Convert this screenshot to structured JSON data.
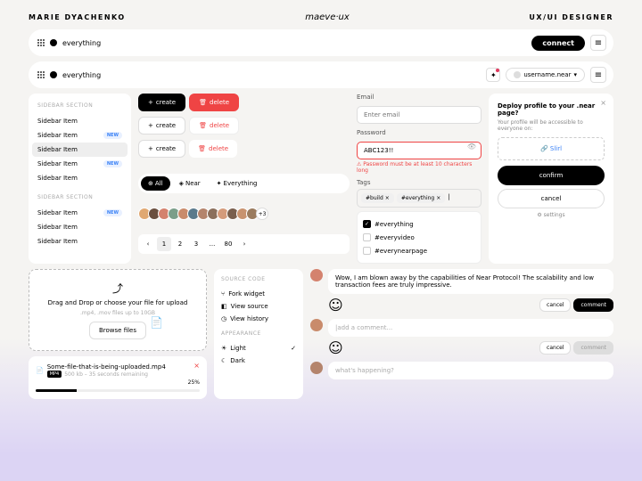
{
  "header": {
    "left": "MARIE DYACHENKO",
    "center": "maeve·ux",
    "right": "UX/UI DESIGNER"
  },
  "bars": {
    "brand": "everything",
    "connect": "connect",
    "username": "username.near"
  },
  "sidebar": {
    "title": "SIDEBAR SECTION",
    "items": [
      {
        "label": "Sidebar Item",
        "new": false
      },
      {
        "label": "Sidebar Item",
        "new": true
      },
      {
        "label": "Sidebar Item",
        "new": false
      },
      {
        "label": "Sidebar Item",
        "new": true
      },
      {
        "label": "Sidebar Item",
        "new": false
      }
    ],
    "title2": "SIDEBAR SECTION",
    "items2": [
      {
        "label": "Sidebar Item",
        "new": true
      },
      {
        "label": "Sidebar Item",
        "new": false
      },
      {
        "label": "Sidebar Item",
        "new": false
      }
    ],
    "new": "NEW"
  },
  "buttons": {
    "create": "create",
    "delete": "delete"
  },
  "segments": {
    "all": "All",
    "near": "Near",
    "everything": "Everything"
  },
  "avatar_colors": [
    "#e0a872",
    "#6b4f3f",
    "#d4826e",
    "#7b9e89",
    "#c98b6b",
    "#5a7a8c",
    "#b4846c",
    "#8b6f5c",
    "#d49b7b",
    "#7a5f4d",
    "#c8936f",
    "#9a7b5e"
  ],
  "avatar_more": "+3",
  "pagination": {
    "prev": "‹",
    "pages": [
      "1",
      "2",
      "3",
      "...",
      "80"
    ],
    "next": "›"
  },
  "form": {
    "email": "Email",
    "email_ph": "Enter email",
    "password": "Password",
    "pw_val": "ABC123!!",
    "pw_err": "⚠ Password must be at least 10 characters long",
    "tags": "Tags",
    "tag1": "#build",
    "tag2": "#everything",
    "chk1": "#everything",
    "chk2": "#everyvideo",
    "chk3": "#everynearpage"
  },
  "deploy": {
    "title": "Deploy profile to your .near page?",
    "sub": "Your profile will be accessible to everyone on:",
    "link": "🔗 Slirl",
    "confirm": "confirm",
    "cancel": "cancel",
    "settings": "⚙ settings"
  },
  "upload": {
    "icon": "⤴",
    "title": "Drag and Drop or choose your file for upload",
    "sub": ".mp4, .mov files up to 10GB",
    "browse": "Browse files",
    "filename": "Some-file-that-is-being-uploaded.mp4",
    "filesub": "500 kb – 35 seconds remaining",
    "pct": "25%",
    "badge": "MP4"
  },
  "menu": {
    "t1": "SOURCE CODE",
    "i1": "Fork widget",
    "i2": "View source",
    "i3": "View history",
    "t2": "APPEARANCE",
    "i4": "Light",
    "i5": "Dark"
  },
  "comments": {
    "c1": "Wow, I am blown away by the capabilities of Near Protocol! The scalability and low transaction fees are truly impressive.",
    "ph": "|add a comment...",
    "c3": "what's happening?",
    "cancel": "cancel",
    "comment": "comment"
  },
  "comment_avatars": [
    "#d4826e",
    "#c98b6b",
    "#b4846c"
  ]
}
